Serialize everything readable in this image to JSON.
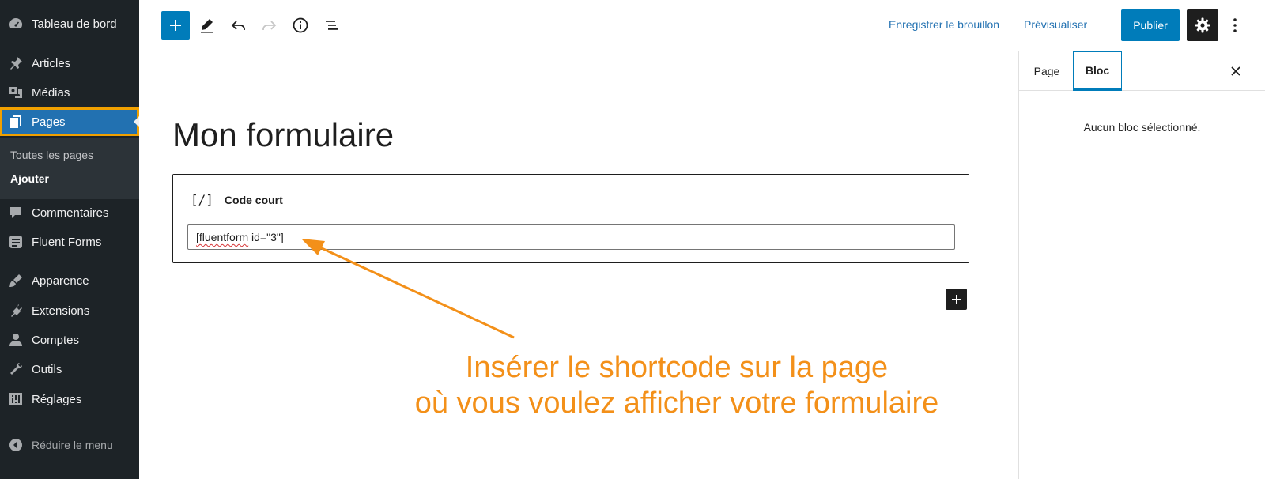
{
  "sidebar": {
    "items": [
      {
        "label": "Tableau de bord",
        "icon": "dashboard-icon"
      },
      {
        "label": "Articles",
        "icon": "pin-icon"
      },
      {
        "label": "Médias",
        "icon": "media-icon"
      },
      {
        "label": "Pages",
        "icon": "pages-icon",
        "active": true
      },
      {
        "label": "Commentaires",
        "icon": "comment-icon"
      },
      {
        "label": "Fluent Forms",
        "icon": "form-icon"
      },
      {
        "label": "Apparence",
        "icon": "brush-icon"
      },
      {
        "label": "Extensions",
        "icon": "plugin-icon"
      },
      {
        "label": "Comptes",
        "icon": "user-icon"
      },
      {
        "label": "Outils",
        "icon": "wrench-icon"
      },
      {
        "label": "Réglages",
        "icon": "settings-sliders-icon"
      }
    ],
    "submenu": [
      "Toutes les pages",
      "Ajouter"
    ],
    "collapse_label": "Réduire le menu"
  },
  "toolbar": {
    "save_draft": "Enregistrer le brouillon",
    "preview": "Prévisualiser",
    "publish": "Publier"
  },
  "editor": {
    "title": "Mon formulaire",
    "block_icon": "[/]",
    "block_label": "Code court",
    "shortcode_word": "[fluentform",
    "shortcode_rest": " id=\"3\"]"
  },
  "annotation": {
    "line1": "Insérer le shortcode sur la page",
    "line2": "où vous voulez afficher votre formulaire"
  },
  "panel": {
    "tab_page": "Page",
    "tab_bloc": "Bloc",
    "empty_message": "Aucun bloc sélectionné."
  },
  "colors": {
    "sidebar_bg": "#1d2327",
    "accent": "#007cba",
    "annotation": "#f39019",
    "focus_outline": "#f0a000"
  }
}
